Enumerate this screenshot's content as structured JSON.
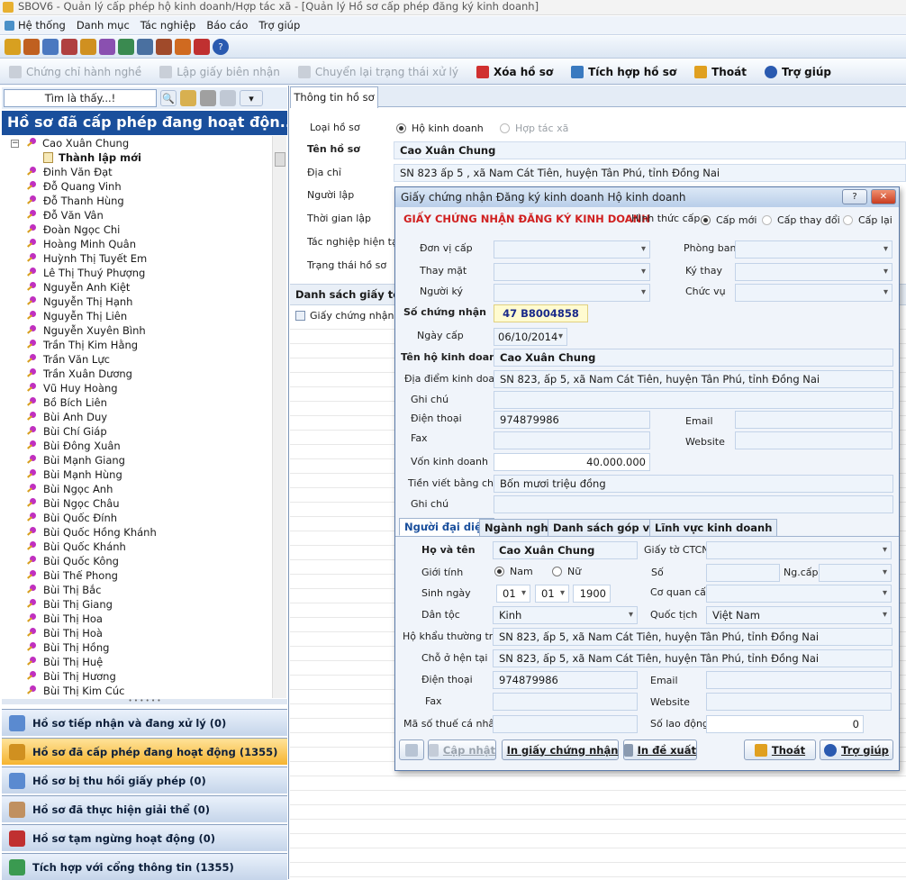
{
  "window": {
    "title": "SBOV6 - Quản lý cấp phép hộ kinh doanh/Hợp tác xã - [Quản lý Hồ sơ cấp phép đăng ký kinh doanh]"
  },
  "menu": [
    "Hệ thống",
    "Danh mục",
    "Tác nghiệp",
    "Báo cáo",
    "Trợ giúp"
  ],
  "toolbar_actions": {
    "chung_chi": "Chứng chỉ hành nghề",
    "lap_giay": "Lập giấy biên nhận",
    "chuyen_lai": "Chuyển lại trạng thái xử lý",
    "xoa": "Xóa hồ sơ",
    "tich_hop": "Tích hợp hồ sơ",
    "thoat": "Thoát",
    "tro_giup": "Trợ giúp"
  },
  "left": {
    "search_label": "Tìm là thấy...!",
    "header": "Hồ sơ đã cấp phép đang hoạt độn...",
    "tree_root": "Cao Xuân Chung",
    "tree_root_child": "Thành lập mới",
    "tree_items": [
      "Đinh Văn Đạt",
      "Đỗ Quang Vinh",
      "Đỗ Thanh Hùng",
      "Đỗ Văn Vân",
      "Đoàn Ngọc Chi",
      "Hoàng Minh Quân",
      "Huỳnh Thị Tuyết Em",
      "Lê Thị Thuý Phượng",
      "Nguyễn Anh Kiệt",
      "Nguyễn Thị Hạnh",
      "Nguyễn Thị Liên",
      "Nguyễn Xuyên Bình",
      "Trần Thị Kim Hằng",
      "Trần Văn Lực",
      "Trần Xuân Dương",
      "Vũ Huy Hoàng",
      "Bồ Bích Liên",
      "Bùi Anh Duy",
      "Bùi Chí Giáp",
      "Bùi Đông Xuân",
      "Bùi Mạnh Giang",
      "Bùi Mạnh Hùng",
      "Bùi Ngọc Anh",
      "Bùi Ngọc Châu",
      "Bùi Quốc Đính",
      "Bùi Quốc Hồng Khánh",
      "Bùi Quốc Khánh",
      "Bùi Quốc Kông",
      "Bùi Thế Phong",
      "Bùi Thị Bắc",
      "Bùi Thị Giang",
      "Bùi Thị Hoa",
      "Bùi Thị Hoà",
      "Bùi Thị Hồng",
      "Bùi Thị Huệ",
      "Bùi Thị Hương",
      "Bùi Thị Kim Cúc"
    ],
    "nav": [
      {
        "label": "Hồ sơ tiếp nhận và đang xử lý (0)"
      },
      {
        "label": "Hồ sơ đã cấp phép đang hoạt động (1355)"
      },
      {
        "label": "Hồ sơ bị thu hồi giấy phép (0)"
      },
      {
        "label": "Hồ sơ đã thực hiện giải thể (0)"
      },
      {
        "label": "Hồ sơ tạm ngừng hoạt động (0)"
      },
      {
        "label": "Tích hợp với cổng thông tin (1355)"
      }
    ]
  },
  "main": {
    "tab": "Thông tin hồ sơ",
    "loai_ho_so_label": "Loại hồ sơ",
    "opt_hkd": "Hộ kinh doanh",
    "opt_htx": "Hợp tác xã",
    "ten_label": "Tên hồ sơ",
    "ten_value": "Cao Xuân Chung",
    "dia_chi_label": "Địa chỉ",
    "dia_chi_value": "SN 823 ấp 5 , xã Nam Cát Tiên, huyện Tân Phú, tỉnh Đồng Nai",
    "nguoi_lap_label": "Người lập",
    "thoi_gian_label": "Thời gian  lập",
    "tac_nghiep_label": "Tác nghiệp hiện tại",
    "trang_thai_label": "Trạng thái hồ sơ",
    "ds_label": "Danh sách giấy tờ",
    "ds_item": "Giấy chứng nhận đă"
  },
  "dialog": {
    "title": "Giấy chứng nhận Đăng ký kinh doanh Hộ kinh doanh",
    "heading": "GIẤY CHỨNG NHẬN ĐĂNG KÝ KINH DOANH",
    "hinh_thuc_label": "Hình thức cấp",
    "hinh_thuc_opts": [
      "Cấp mới",
      "Cấp thay đổi",
      "Cấp lại"
    ],
    "don_vi_cap": "Đơn vị cấp",
    "phong_ban": "Phòng ban",
    "thay_mat": "Thay mặt",
    "ky_thay": "Ký thay",
    "nguoi_ky": "Người ký",
    "chuc_vu": "Chức vụ",
    "so_cn_label": "Số chứng nhận",
    "so_cn_value": "47 B8004858",
    "ngay_cap_label": "Ngày cấp",
    "ngay_cap_value": "06/10/2014",
    "ten_hkd_label": "Tên hộ kinh doanh",
    "ten_hkd_value": "Cao Xuân Chung",
    "dia_diem_label": "Địa điểm kinh doanh",
    "dia_diem_value": "SN 823, ấp 5, xã Nam Cát Tiên, huyện Tân Phú, tỉnh Đồng Nai",
    "ghi_chu_label": "Ghi chú",
    "dien_thoai_label": "Điện thoại",
    "dien_thoai_value": "974879986",
    "email_label": "Email",
    "fax_label": "Fax",
    "website_label": "Website",
    "von_label": "Vốn kinh doanh",
    "von_value": "40.000.000",
    "tien_chu_label": "Tiền viết bằng chữ",
    "tien_chu_value": "Bốn mươi triệu đồng",
    "ghi_chu2_label": "Ghi chú",
    "tabs": [
      "Người đại diện",
      "Ngành nghề",
      "Danh sách góp vốn",
      "Lĩnh vực kinh doanh"
    ],
    "rep": {
      "ho_ten_label": "Họ và tên",
      "ho_ten_value": "Cao Xuân Chung",
      "giay_to_label": "Giấy tờ CTCN",
      "gioi_tinh_label": "Giới tính",
      "nam": "Nam",
      "nu": "Nữ",
      "so_label": "Số",
      "ng_cap_label": "Ng.cấp",
      "sinh_ngay_label": "Sinh ngày",
      "day": "01",
      "month": "01",
      "year": "1900",
      "co_quan_label": "Cơ quan cấp",
      "dan_toc_label": "Dân tộc",
      "dan_toc_value": "Kinh",
      "quoc_tich_label": "Quốc tịch",
      "quoc_tich_value": "Việt Nam",
      "ho_khau_label": "Hộ khẩu thường trú",
      "ho_khau_value": "SN 823, ấp 5, xã Nam Cát Tiên, huyện Tân Phú, tỉnh Đồng Nai",
      "cho_o_label": "Chỗ ở hện tại",
      "cho_o_value": "SN 823, ấp 5, xã Nam Cát Tiên, huyện Tân Phú, tỉnh Đồng Nai",
      "dien_thoai_label": "Điện thoại",
      "dien_thoai_value": "974879986",
      "email_label": "Email",
      "fax_label": "Fax",
      "website_label": "Website",
      "mst_label": "Mã số thuế cá nhân",
      "so_ld_label": "Số lao động",
      "so_ld_value": "0"
    },
    "buttons": {
      "cap_nhat": "Cập nhật",
      "in_gcn": "In giấy chứng nhận",
      "in_de_xuat": "In đề xuất",
      "thoat": "Thoát",
      "tro_giup": "Trợ giúp"
    }
  }
}
